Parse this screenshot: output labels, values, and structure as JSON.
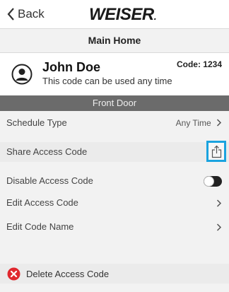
{
  "header": {
    "back_label": "Back",
    "logo_text": "WEISER",
    "logo_dot": "."
  },
  "subheader": {
    "title": "Main Home"
  },
  "user": {
    "name": "John Doe",
    "description": "This code can be used any time",
    "code_label": "Code: 1234"
  },
  "section": {
    "title": "Front Door"
  },
  "rows": {
    "schedule_type": {
      "label": "Schedule Type",
      "value": "Any Time"
    },
    "share_access_code": {
      "label": "Share Access Code"
    },
    "disable_access_code": {
      "label": "Disable Access Code",
      "toggle_on": false
    },
    "edit_access_code": {
      "label": "Edit Access Code"
    },
    "edit_code_name": {
      "label": "Edit Code Name"
    }
  },
  "delete": {
    "label": "Delete Access Code"
  },
  "colors": {
    "highlight": "#1aa3df",
    "delete_icon": "#e0282e",
    "section_bg": "#6b6b6b"
  }
}
